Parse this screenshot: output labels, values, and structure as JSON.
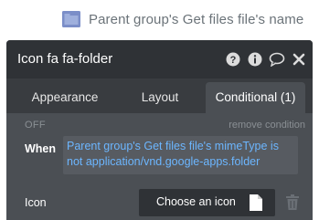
{
  "top": {
    "label": "Parent group's Get files file's name",
    "icon": "folder-icon"
  },
  "panel": {
    "title": "Icon fa fa-folder",
    "header_icons": [
      "help-icon",
      "info-icon",
      "comment-icon",
      "close-icon"
    ],
    "tabs": [
      {
        "label": "Appearance",
        "active": false
      },
      {
        "label": "Layout",
        "active": false
      },
      {
        "label": "Conditional (1)",
        "active": true
      }
    ],
    "condition": {
      "state": "OFF",
      "remove_label": "remove condition",
      "when_label": "When",
      "expression": "Parent group's Get files file's mimeType is not application/vnd.google-apps.folder"
    },
    "property": {
      "label": "Icon",
      "button_label": "Choose an icon"
    }
  },
  "colors": {
    "header_bg": "#2f3236",
    "panel_bg": "#393c40",
    "content_bg": "#4b4f54",
    "expression_text": "#6cb6ff"
  }
}
